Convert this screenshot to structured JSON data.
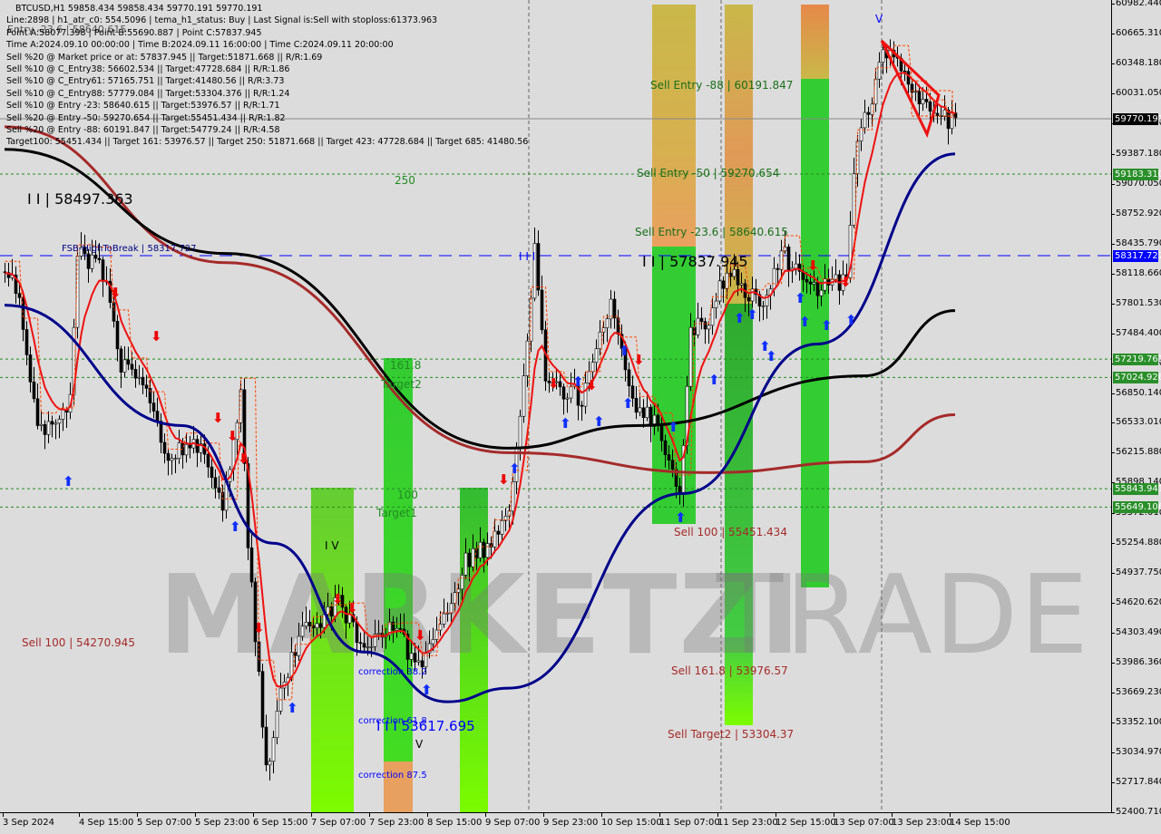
{
  "header": {
    "title": "BTCUSD,H1  59858.434 59858.434 59770.191 59770.191",
    "lines": [
      "Line:2898 | h1_atr_c0: 554.5096 | tema_h1_status: Buy | Last Signal is:Sell with stoploss:61373.963",
      "Point A:58077.398 | Point B:55690.887 | Point C:57837.945",
      "Time A:2024.09.10 00:00:00 | Time B:2024.09.11 16:00:00 | Time C:2024.09.11 20:00:00",
      "Sell %20 @ Market price or at: 57837.945 || Target:51871.668 || R/R:1.69",
      "Sell %10 @ C_Entry38: 56602.534 || Target:47728.684 || R/R:1.86",
      "Sell %10 @ C_Entry61: 57165.751 || Target:41480.56 || R/R:3.73",
      "Sell %10 @ C_Entry88: 57779.084 || Target:53304.376 || R/R:1.24",
      "Sell %10 @ Entry -23: 58640.615 || Target:53976.57 || R/R:1.71",
      "Sell %20 @ Entry -50: 59270.654 || Target:55451.434 || R/R:1.82",
      "Sell %20 @ Entry -88: 60191.847 || Target:54779.24 || R/R:4.58",
      "Target100: 55451.434 || Target 161: 53976.57 || Target 250: 51871.668 || Target 423: 47728.684 || Target 685: 41480.56"
    ],
    "overlap_text": "Entry -23.6 | 58640.615"
  },
  "watermark": {
    "left": "MARKETZI",
    "right": "TRADE"
  },
  "annotations": {
    "pivot_high": "I I | 58497.363",
    "fsb": "FSB-HighToBreak | 58317.727",
    "fib_250": "250",
    "fib_161": "161.8",
    "target2": "Target2",
    "fib_100": "100",
    "target1": "Target1",
    "sell_entry_88": "Sell Entry -88 | 60191.847",
    "sell_entry_50": "Sell Entry -50 | 59270.654",
    "sell_entry_23": "Sell Entry -23.6 | 58640.615",
    "point_c": "I I | 57837.945",
    "point_iii": "I I I",
    "sell_100_right": "Sell 100 | 55451.434",
    "sell_100_left": "Sell 100 | 54270.945",
    "sell_161": "Sell 161.8 | 53976.57",
    "sell_target2": "Sell Target2 | 53304.37",
    "corr_38": "correction 38.2",
    "corr_61": "correction 61.8",
    "corr_87": "correction 87.5",
    "low_label": "I I I 53617.695",
    "wave_iv": "I V",
    "wave_v_top": "V",
    "wave_v_low": "V"
  },
  "chart_data": {
    "type": "candlestick",
    "symbol": "BTCUSD",
    "timeframe": "H1",
    "ylim": [
      52400.71,
      60982.44
    ],
    "y_ticks": [
      "60982.440",
      "60665.310",
      "60348.180",
      "60031.050",
      "59713.920",
      "59387.180",
      "59070.050",
      "58752.920",
      "58435.790",
      "58118.660",
      "57801.530",
      "57484.400",
      "57167.270",
      "56850.140",
      "56533.010",
      "56215.880",
      "55898.140",
      "55572.010",
      "55254.880",
      "54937.750",
      "54620.620",
      "54303.490",
      "53986.360",
      "53669.230",
      "53352.100",
      "53034.970",
      "52717.840",
      "52400.710"
    ],
    "x_ticks": [
      "3 Sep 2024",
      "4 Sep 15:00",
      "5 Sep 07:00",
      "5 Sep 23:00",
      "6 Sep 15:00",
      "7 Sep 07:00",
      "7 Sep 23:00",
      "8 Sep 15:00",
      "9 Sep 07:00",
      "9 Sep 23:00",
      "10 Sep 15:00",
      "11 Sep 07:00",
      "11 Sep 23:00",
      "12 Sep 15:00",
      "13 Sep 07:00",
      "13 Sep 23:00",
      "14 Sep 15:00"
    ],
    "price_path": [
      [
        "2024-09-03 23:00",
        58147
      ],
      [
        "2024-09-04 03:00",
        57859
      ],
      [
        "2024-09-04 08:00",
        56418
      ],
      [
        "2024-09-04 17:00",
        56802
      ],
      [
        "2024-09-04 19:00",
        58340
      ],
      [
        "2024-09-05 02:00",
        58147
      ],
      [
        "2024-09-05 07:00",
        57186
      ],
      [
        "2024-09-05 14:00",
        56898
      ],
      [
        "2024-09-05 19:00",
        56226
      ],
      [
        "2024-09-06 05:00",
        56322
      ],
      [
        "2024-09-06 11:00",
        55649
      ],
      [
        "2024-09-06 16:00",
        56898
      ],
      [
        "2024-09-06 18:00",
        55265
      ],
      [
        "2024-09-06 23:00",
        52862
      ],
      [
        "2024-09-07 04:00",
        53823
      ],
      [
        "2024-09-07 09:00",
        54303
      ],
      [
        "2024-09-07 14:00",
        54399
      ],
      [
        "2024-09-07 19:00",
        54688
      ],
      [
        "2024-09-08 02:00",
        54111
      ],
      [
        "2024-09-08 10:00",
        54399
      ],
      [
        "2024-09-08 17:00",
        53919
      ],
      [
        "2024-09-09 01:00",
        54495
      ],
      [
        "2024-09-09 06:00",
        55072
      ],
      [
        "2024-09-09 13:00",
        55265
      ],
      [
        "2024-09-09 18:00",
        55649
      ],
      [
        "2024-09-09 22:00",
        56994
      ],
      [
        "2024-09-10 01:00",
        58340
      ],
      [
        "2024-09-10 04:00",
        56994
      ],
      [
        "2024-09-10 14:00",
        56802
      ],
      [
        "2024-09-10 22:00",
        57859
      ],
      [
        "2024-09-11 05:00",
        56610
      ],
      [
        "2024-09-11 10:00",
        56610
      ],
      [
        "2024-09-11 17:00",
        55793
      ],
      [
        "2024-09-11 20:00",
        57475
      ],
      [
        "2024-09-12 01:00",
        57667
      ],
      [
        "2024-09-12 06:00",
        58147
      ],
      [
        "2024-09-12 11:00",
        57955
      ],
      [
        "2024-09-12 16:00",
        57859
      ],
      [
        "2024-09-12 21:00",
        58340
      ],
      [
        "2024-09-13 07:00",
        57955
      ],
      [
        "2024-09-13 15:00",
        58051
      ],
      [
        "2024-09-13 18:00",
        59589
      ],
      [
        "2024-09-13 22:00",
        59973
      ],
      [
        "2024-09-14 01:00",
        60550
      ],
      [
        "2024-09-14 06:00",
        60358
      ],
      [
        "2024-09-14 11:00",
        59973
      ],
      [
        "2024-09-14 16:00",
        59781
      ],
      [
        "2024-09-14 21:00",
        59770.191
      ]
    ],
    "moving_averages": [
      {
        "color": "#a52a2a",
        "points": [
          [
            "2024-09-03 23:00",
            59685
          ],
          [
            "2024-09-06 12:00",
            58243
          ],
          [
            "2024-09-09 18:00",
            56226
          ],
          [
            "2024-09-12 01:00",
            56014
          ],
          [
            "2024-09-13 20:00",
            56130
          ],
          [
            "2024-09-14 21:00",
            56629
          ]
        ]
      },
      {
        "color": "#000000",
        "points": [
          [
            "2024-09-03 23:00",
            59445
          ],
          [
            "2024-09-06 12:00",
            58340
          ],
          [
            "2024-09-09 18:00",
            56274
          ],
          [
            "2024-09-11 05:00",
            56514
          ],
          [
            "2024-09-13 20:00",
            57042
          ],
          [
            "2024-09-14 21:00",
            57734
          ]
        ]
      },
      {
        "color": "#00008b",
        "points": [
          [
            "2024-09-03 23:00",
            57792
          ],
          [
            "2024-09-06 00:00",
            56514
          ],
          [
            "2024-09-07 01:00",
            55265
          ],
          [
            "2024-09-08 02:00",
            54111
          ],
          [
            "2024-09-09 01:00",
            53583
          ],
          [
            "2024-09-09 18:00",
            53727
          ],
          [
            "2024-09-11 18:00",
            55793
          ],
          [
            "2024-09-13 07:00",
            57379
          ],
          [
            "2024-09-14 21:00",
            59397
          ]
        ]
      }
    ],
    "levels": [
      {
        "price": 59770.191,
        "label": "59770.191",
        "color": "#000000",
        "style": "solid"
      },
      {
        "price": 59183.31,
        "label": "59183.310",
        "color": "#228b22",
        "style": "dotted"
      },
      {
        "price": 58317.727,
        "label": "58317.727",
        "color": "#0000ff",
        "style": "dashed"
      },
      {
        "price": 57219.761,
        "label": "57219.761",
        "color": "#228b22",
        "style": "dotted"
      },
      {
        "price": 57024.926,
        "label": "57024.926",
        "color": "#228b22",
        "style": "dotted"
      },
      {
        "price": 55843.941,
        "label": "55843.941",
        "color": "#228b22",
        "style": "dotted"
      },
      {
        "price": 55649.106,
        "label": "55649.106",
        "color": "#228b22",
        "style": "dotted"
      }
    ]
  }
}
